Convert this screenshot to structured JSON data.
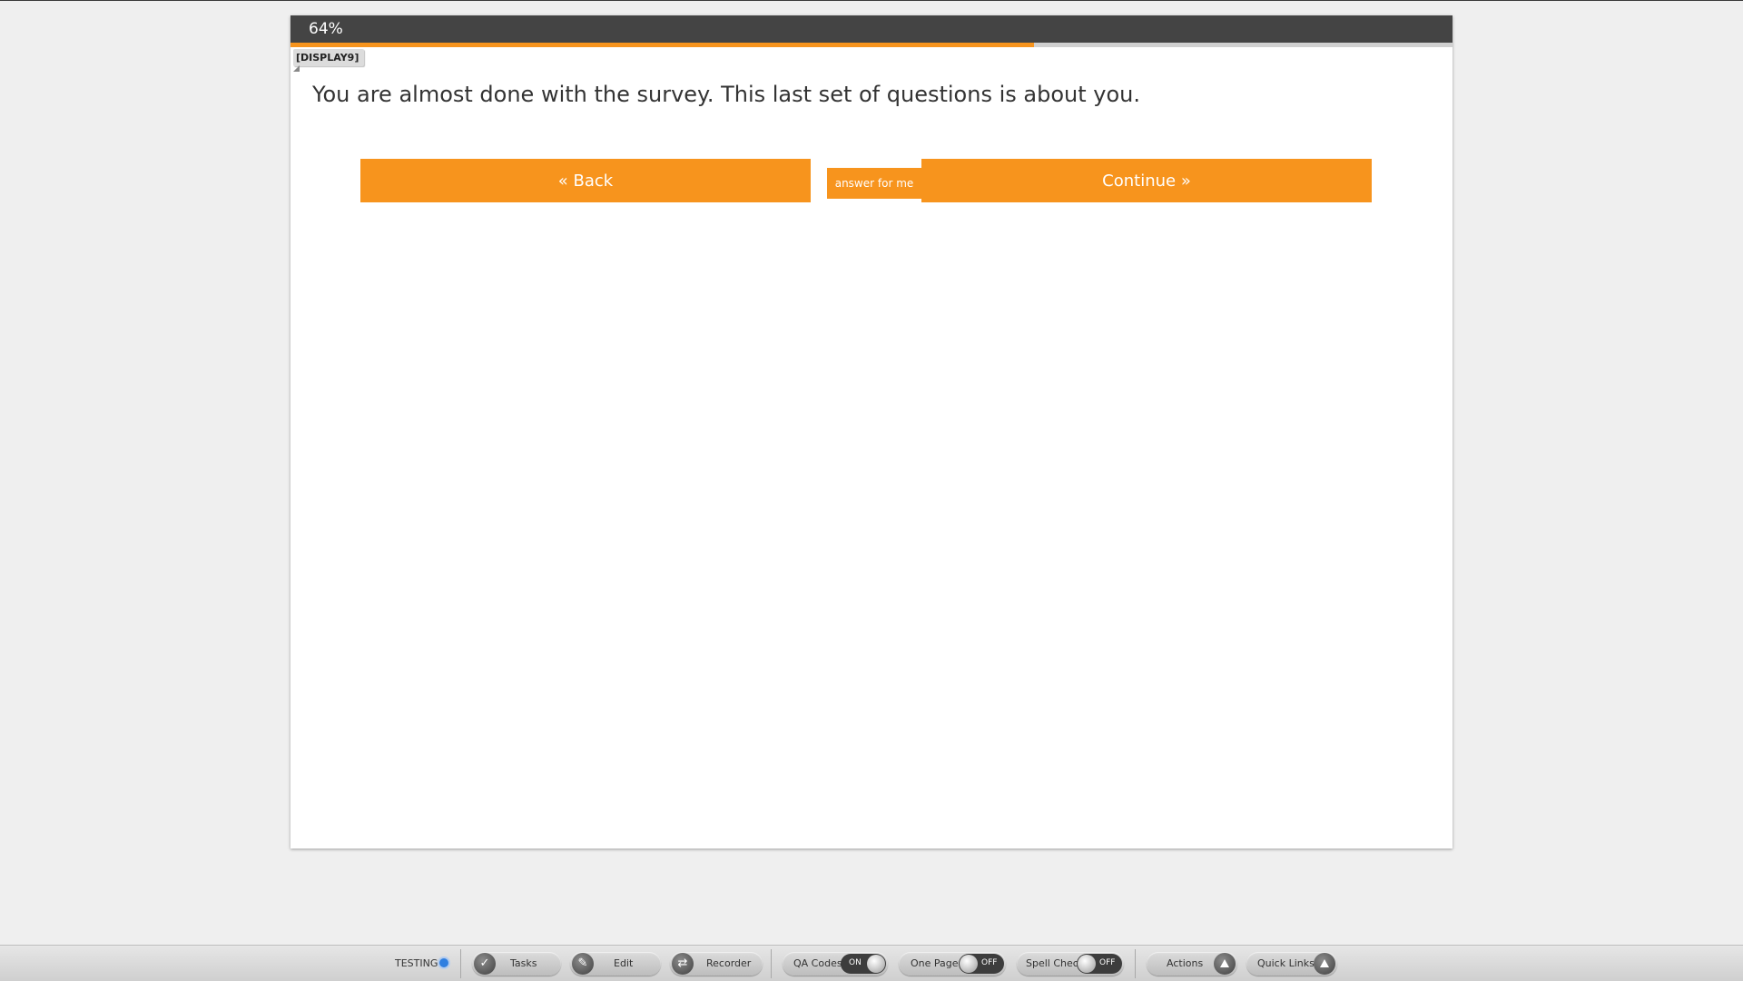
{
  "progress": {
    "label": "64%",
    "fraction": 0.64
  },
  "qa_code": "[DISPLAY9]",
  "question": {
    "text": "You are almost done with the survey. This last set of questions is about you."
  },
  "buttons": {
    "back": "« Back",
    "answer_for_me": "answer for me",
    "continue": "Continue »"
  },
  "toolbar": {
    "testing": "TESTING",
    "tasks": "Tasks",
    "edit": "Edit",
    "recorder": "Recorder",
    "qa_codes": {
      "label": "QA Codes",
      "state": "ON"
    },
    "one_page": {
      "label": "One Page",
      "state": "OFF"
    },
    "spell_check": {
      "label": "Spell Check",
      "state": "OFF"
    },
    "actions": "Actions",
    "quick_links": "Quick Links"
  },
  "colors": {
    "accent": "#f7941d",
    "header": "#444444",
    "testing_dot": "#2f7fe0"
  }
}
